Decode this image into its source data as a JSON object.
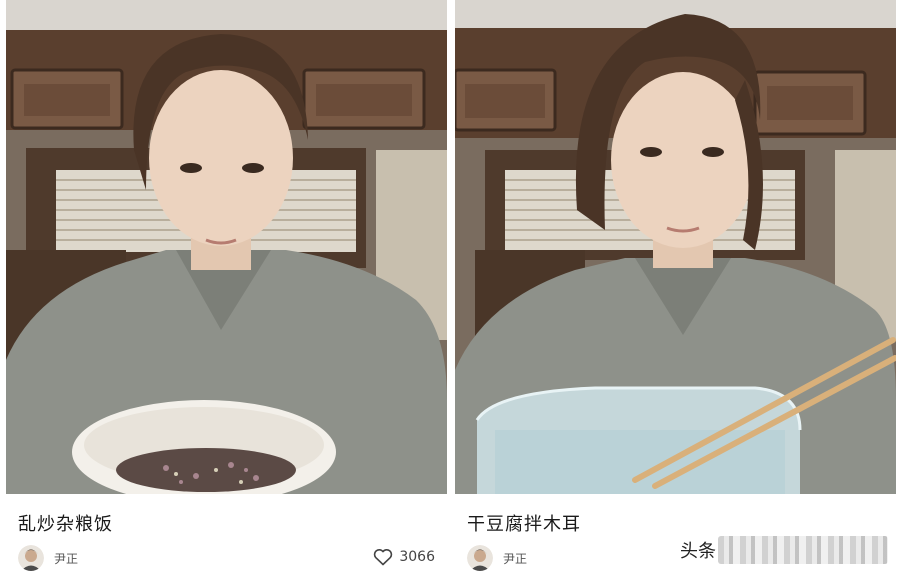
{
  "cards": [
    {
      "title": "乱炒杂粮饭",
      "author": "尹正",
      "likes": "3066",
      "icons": {
        "avatar": "author-avatar",
        "like": "heart-icon"
      }
    },
    {
      "title": "干豆腐拌木耳",
      "author": "尹正",
      "icons": {
        "avatar": "author-avatar"
      }
    }
  ],
  "watermark": {
    "text": "头条",
    "suffix_blurred": true
  },
  "colors": {
    "background": "#ffffff",
    "title": "#1a1a1a",
    "meta": "#555555",
    "shirt": "#8e918a",
    "cabinet": "#5a3f2e"
  }
}
